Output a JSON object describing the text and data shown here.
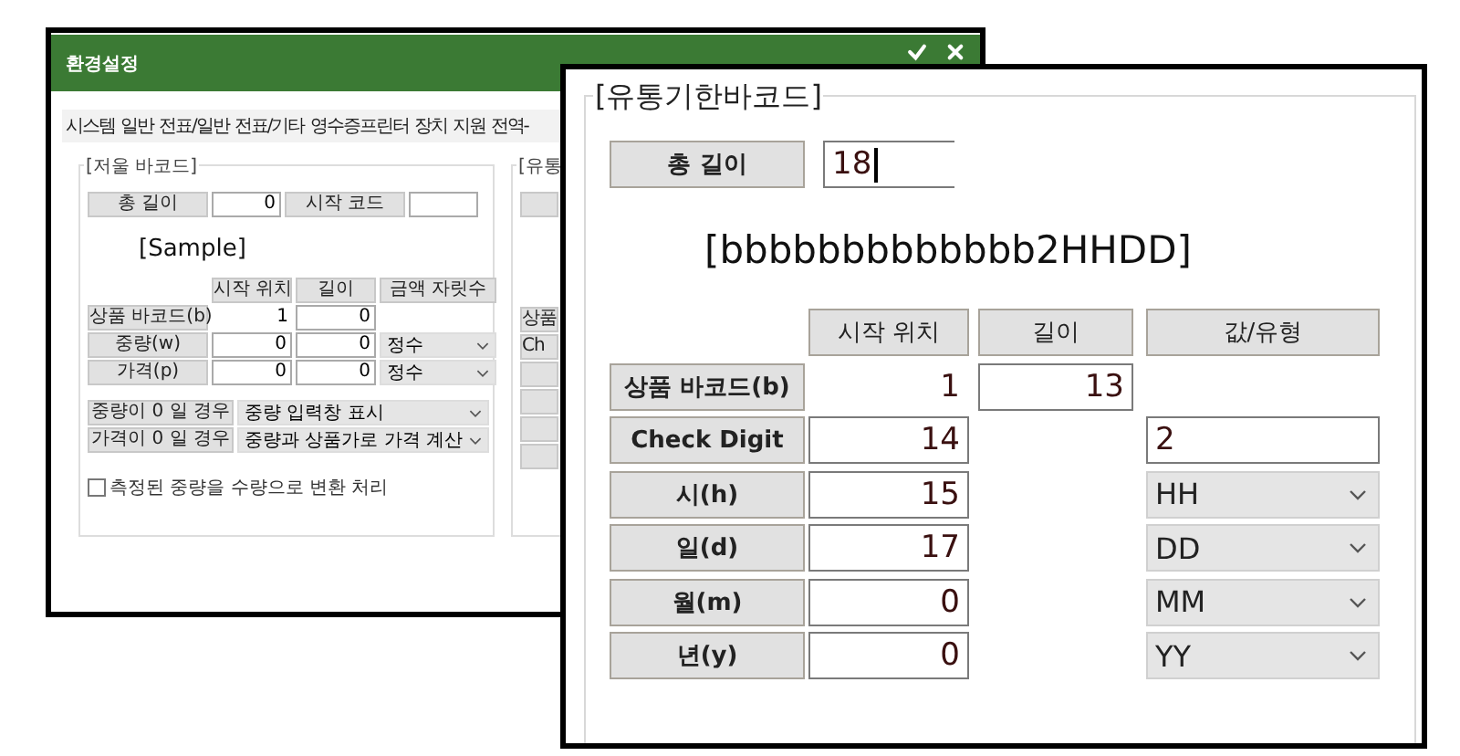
{
  "background_window": {
    "title": "환경설정",
    "tabs": [
      {
        "label": "시스템"
      },
      {
        "label": "일반"
      },
      {
        "label": "전표/일반"
      },
      {
        "label": "전표/기타"
      },
      {
        "label": "영수증프린터"
      },
      {
        "label": "장치"
      },
      {
        "label": "지원"
      },
      {
        "label": "전역-"
      }
    ],
    "left_group": {
      "title": "[저울 바코드]",
      "total_length_label": "총 길이",
      "total_length": "0",
      "start_code_label": "시작 코드",
      "sample": "[Sample]",
      "columns": [
        "시작 위치",
        "길이",
        "금액 자릿수"
      ],
      "rows": [
        {
          "label": "상품 바코드(b)",
          "start": {
            "kind": "text",
            "value": "1"
          },
          "length": "0"
        },
        {
          "label": "중량(w)",
          "start": {
            "kind": "input",
            "value": "0"
          },
          "length": "0",
          "format": "정수"
        },
        {
          "label": "가격(p)",
          "start": {
            "kind": "input",
            "value": "0"
          },
          "length": "0",
          "format": "정수"
        }
      ],
      "options": [
        {
          "label": "중량이 0 일 경우",
          "value": "중량 입력창 표시"
        },
        {
          "label": "가격이 0 일 경우",
          "value": "중량과 상품가로 가격 계산"
        }
      ],
      "checkbox": {
        "label": "측정된 중량을 수량으로 변환 처리",
        "checked": false
      }
    },
    "right_group": {
      "title": "[유통",
      "row_labels": [
        "상품",
        "Ch"
      ]
    }
  },
  "detail_window": {
    "title": "[유통기한바코드]",
    "total_length_label": "총 길이",
    "total_length": "18",
    "sample": "[bbbbbbbbbbbbb2HHDD]",
    "columns": [
      "시작 위치",
      "길이",
      "값/유형"
    ],
    "rows": [
      {
        "label": "상품 바코드(b)",
        "start": {
          "kind": "text",
          "value": "1"
        },
        "length": "13"
      },
      {
        "label": "Check Digit",
        "start": {
          "kind": "input",
          "value": "14"
        },
        "value": {
          "kind": "input",
          "text": "2"
        }
      },
      {
        "label": "시(h)",
        "start": {
          "kind": "input",
          "value": "15"
        },
        "value": {
          "kind": "select",
          "text": "HH"
        }
      },
      {
        "label": "일(d)",
        "start": {
          "kind": "input",
          "value": "17"
        },
        "value": {
          "kind": "select",
          "text": "DD"
        }
      },
      {
        "label": "월(m)",
        "start": {
          "kind": "input",
          "value": "0"
        },
        "value": {
          "kind": "select",
          "text": "MM"
        }
      },
      {
        "label": "년(y)",
        "start": {
          "kind": "input",
          "value": "0"
        },
        "value": {
          "kind": "select",
          "text": "YY"
        }
      }
    ]
  }
}
